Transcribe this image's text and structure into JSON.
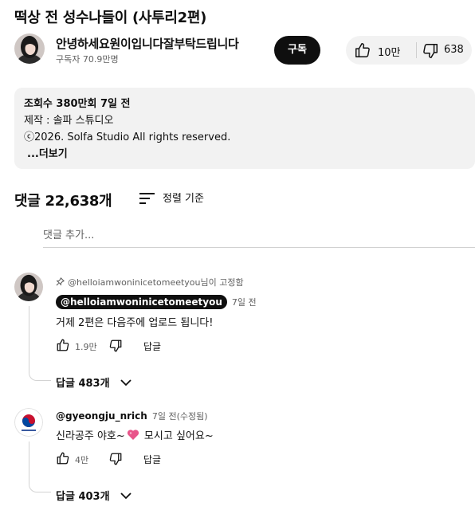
{
  "video": {
    "title": "떡상 전 성수나들이 (사투리2편)"
  },
  "channel": {
    "name": "안녕하세요원이입니다잘부탁드립니다",
    "subscribers": "구독자 70.9만명",
    "subscribe_label": "구독",
    "avatar_icon": "channel-avatar-photo"
  },
  "actions": {
    "like_count": "10만",
    "dislike_count": "638",
    "like_icon": "thumbs-up-icon",
    "dislike_icon": "thumbs-down-icon"
  },
  "description": {
    "views_date": "조회수 380만회  7일 전",
    "producer": "제작 : 솔파 스튜디오",
    "copyright": "ⓒ2026. Solfa Studio All rights reserved.",
    "more_label": "...더보기"
  },
  "comments": {
    "count_label": "댓글 22,638개",
    "sort_label": "정렬 기준",
    "add_placeholder": "댓글 추가...",
    "items": [
      {
        "pinned_text": "@helloiamwoninicetomeetyou님이 고정함",
        "author": "@helloiamwoninicetomeetyou",
        "time": "7일 전",
        "text": "거제 2편은 다음주에 업로드 됩니다!",
        "likes": "1.9만",
        "reply_label": "답글",
        "replies_label": "답글 483개"
      },
      {
        "author": "@gyeongju_nrich",
        "time": "7일 전(수정됨)",
        "text_before": "신라공주 야호~",
        "text_after": " 모시고 싶어요~",
        "likes": "4만",
        "reply_label": "답글",
        "replies_label": "답글 403개"
      }
    ]
  },
  "colors": {
    "primary_text": "#0f0f0f",
    "secondary_text": "#606060",
    "chip_bg": "#f2f2f2",
    "heart": "#e8558a"
  }
}
